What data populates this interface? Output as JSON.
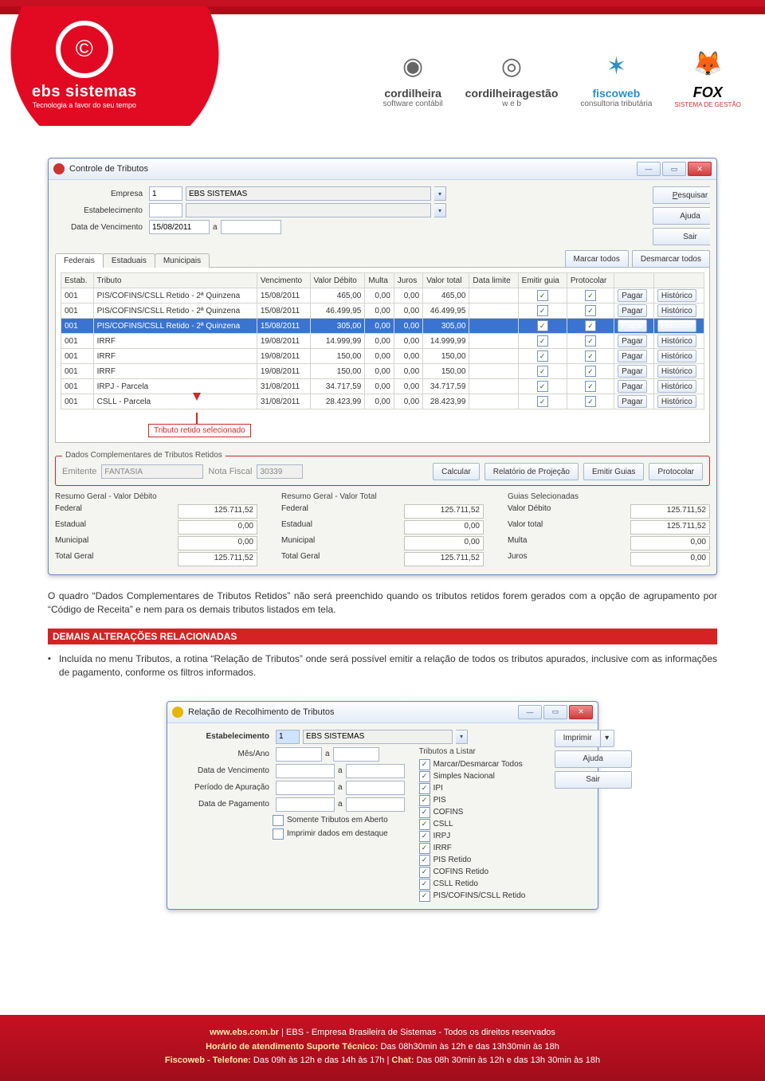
{
  "header": {
    "company": "ebs sistemas",
    "tagline": "Tecnologia a favor do seu tempo",
    "partners": [
      {
        "name": "cordilheira",
        "sub": "software contábil"
      },
      {
        "name": "cordilheiragestão",
        "sub": "w  e  b"
      },
      {
        "name": "fiscoweb",
        "sub": "consultoria tributária"
      },
      {
        "name": "FOX",
        "sub": "SISTEMA DE GESTÃO"
      }
    ]
  },
  "win1": {
    "title": "Controle de Tributos",
    "empresa_label": "Empresa",
    "empresa_code": "1",
    "empresa_name": "EBS SISTEMAS",
    "estab_label": "Estabelecimento",
    "venc_label": "Data de Vencimento",
    "venc": "15/08/2011",
    "a": "a",
    "btn_pesquisar": "Pesquisar",
    "btn_ajuda": "Ajuda",
    "btn_sair": "Sair",
    "btn_marcar": "Marcar todos",
    "btn_desmarcar": "Desmarcar todos",
    "tabs": [
      "Federais",
      "Estaduais",
      "Municipais"
    ],
    "cols": [
      "Estab.",
      "Tributo",
      "Vencimento",
      "Valor Débito",
      "Multa",
      "Juros",
      "Valor total",
      "Data limite",
      "Emitir guia",
      "Protocolar",
      "",
      ""
    ],
    "rows": [
      {
        "e": "001",
        "t": "PIS/COFINS/CSLL Retido - 2ª Quinzena",
        "v": "15/08/2011",
        "vd": "465,00",
        "m": "0,00",
        "j": "0,00",
        "vt": "465,00",
        "g": true,
        "p": true
      },
      {
        "e": "001",
        "t": "PIS/COFINS/CSLL Retido - 2ª Quinzena",
        "v": "15/08/2011",
        "vd": "46.499,95",
        "m": "0,00",
        "j": "0,00",
        "vt": "46.499,95",
        "g": true,
        "p": true
      },
      {
        "e": "001",
        "t": "PIS/COFINS/CSLL Retido - 2ª Quinzena",
        "v": "15/08/2011",
        "vd": "305,00",
        "m": "0,00",
        "j": "0,00",
        "vt": "305,00",
        "g": true,
        "p": true,
        "sel": true
      },
      {
        "e": "001",
        "t": "IRRF",
        "v": "19/08/2011",
        "vd": "14.999,99",
        "m": "0,00",
        "j": "0,00",
        "vt": "14.999,99",
        "g": true,
        "p": true
      },
      {
        "e": "001",
        "t": "IRRF",
        "v": "19/08/2011",
        "vd": "150,00",
        "m": "0,00",
        "j": "0,00",
        "vt": "150,00",
        "g": true,
        "p": true
      },
      {
        "e": "001",
        "t": "IRRF",
        "v": "19/08/2011",
        "vd": "150,00",
        "m": "0,00",
        "j": "0,00",
        "vt": "150,00",
        "g": true,
        "p": true
      },
      {
        "e": "001",
        "t": "IRPJ - Parcela",
        "v": "31/08/2011",
        "vd": "34.717,59",
        "m": "0,00",
        "j": "0,00",
        "vt": "34.717,59",
        "g": true,
        "p": true
      },
      {
        "e": "001",
        "t": "CSLL - Parcela",
        "v": "31/08/2011",
        "vd": "28.423,99",
        "m": "0,00",
        "j": "0,00",
        "vt": "28.423,99",
        "g": true,
        "p": true
      }
    ],
    "btn_pagar": "Pagar",
    "btn_hist": "Histórico",
    "annot": "Tributo retido selecionado",
    "group_title": "Dados Complementares de Tributos Retidos",
    "emitente_label": "Emitente",
    "emitente": "FANTASIA",
    "nf_label": "Nota Fiscal",
    "nf": "30339",
    "btn_calc": "Calcular",
    "btn_rel": "Relatório de Projeção",
    "btn_emitir": "Emitir Guias",
    "btn_prot": "Protocolar",
    "sum": {
      "c1": {
        "h": "Resumo Geral - Valor Débito",
        "Federal": "125.711,52",
        "Estadual": "0,00",
        "Municipal": "0,00",
        "Total Geral": "125.711,52"
      },
      "c2": {
        "h": "Resumo Geral - Valor Total",
        "Federal": "125.711,52",
        "Estadual": "0,00",
        "Municipal": "0,00",
        "Total Geral": "125.711,52"
      },
      "c3": {
        "h": "Guias Selecionadas",
        "Valor Débito": "125.711,52",
        "Valor total": "125.711,52",
        "Multa": "0,00",
        "Juros": "0,00"
      }
    }
  },
  "para1": "O quadro “Dados Complementares de Tributos Retidos” não será preenchido quando os tributos retidos forem gerados com a opção de agrupamento por “Código de Receita” e nem para os demais tributos listados em tela.",
  "section": "DEMAIS ALTERAÇÕES RELACIONADAS",
  "bullet": "Incluída no menu Tributos, a rotina “Relação de Tributos” onde será possível emitir a relação de todos os tributos apurados, inclusive com as informações de pagamento, conforme os filtros informados.",
  "win2": {
    "title": "Relação de Recolhimento de Tributos",
    "estab_label": "Estabelecimento",
    "estab_code": "1",
    "estab_name": "EBS SISTEMAS",
    "mes_label": "Mês/Ano",
    "a": "a",
    "dv_label": "Data de Vencimento",
    "pa_label": "Período de Apuração",
    "dp_label": "Data de Pagamento",
    "cb1": "Somente Tributos em Aberto",
    "cb2": "Imprimir dados em destaque",
    "tri_h": "Tributos a Listar",
    "tri": [
      "Marcar/Desmarcar Todos",
      "Simples Nacional",
      "IPI",
      "PIS",
      "COFINS",
      "CSLL",
      "IRPJ",
      "IRRF",
      "PIS Retido",
      "COFINS Retido",
      "CSLL Retido",
      "PIS/COFINS/CSLL Retido"
    ],
    "btn_imp": "Imprimir",
    "btn_ajuda": "Ajuda",
    "btn_sair": "Sair"
  },
  "footer": {
    "l1a": "www.ebs.com.br",
    "l1b": " | EBS - Empresa Brasileira de Sistemas - Todos os direitos reservados",
    "l2a": "Horário de atendimento Suporte Técnico:",
    "l2b": " Das 08h30min às 12h e das 13h30min às 18h",
    "l3a": "Fiscoweb - Telefone:",
    "l3b": " Das 09h às 12h e das 14h às 17h | ",
    "l3c": "Chat:",
    "l3d": " Das 08h 30min às 12h e das 13h 30min às 18h"
  }
}
